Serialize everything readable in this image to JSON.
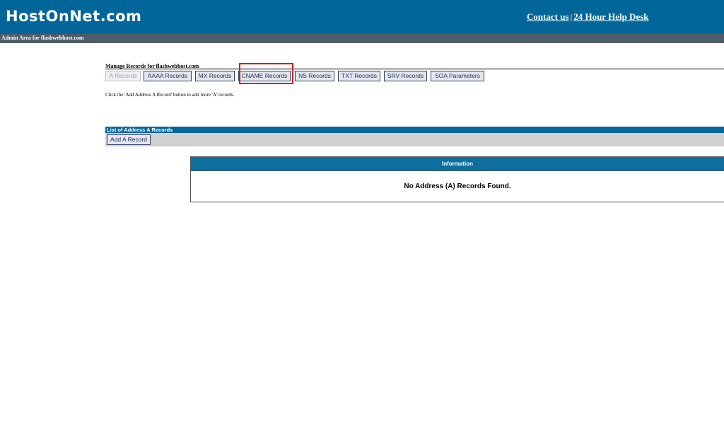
{
  "header": {
    "logo": "HostOnNet.com",
    "contact_label": "Contact us",
    "separator": "|",
    "helpdesk_label": "24 Hour Help Desk"
  },
  "subbar": {
    "text": "Admin Area for flashwebhost.com"
  },
  "manage": {
    "title": "Manage Records for flashwebhost.com",
    "tabs": [
      {
        "label": "A Records",
        "disabled": true
      },
      {
        "label": "AAAA Records"
      },
      {
        "label": "MX Records"
      },
      {
        "label": "CNAME Records",
        "highlighted": true
      },
      {
        "label": "NS Records"
      },
      {
        "label": "TXT Records"
      },
      {
        "label": "SRV Records"
      },
      {
        "label": "SOA Parameters"
      }
    ],
    "instruction": "Click the 'Add Address A Record' button to add more 'A' records."
  },
  "list": {
    "header": "List of Address A Records",
    "add_button": "Add A Record"
  },
  "info": {
    "header": "Information",
    "message": "No Address (A) Records Found."
  },
  "colors": {
    "header_bg": "#016699",
    "subbar_bg": "#4f5d6b",
    "highlight": "#e0151b",
    "toolbar_bg": "#d0d0d0"
  }
}
